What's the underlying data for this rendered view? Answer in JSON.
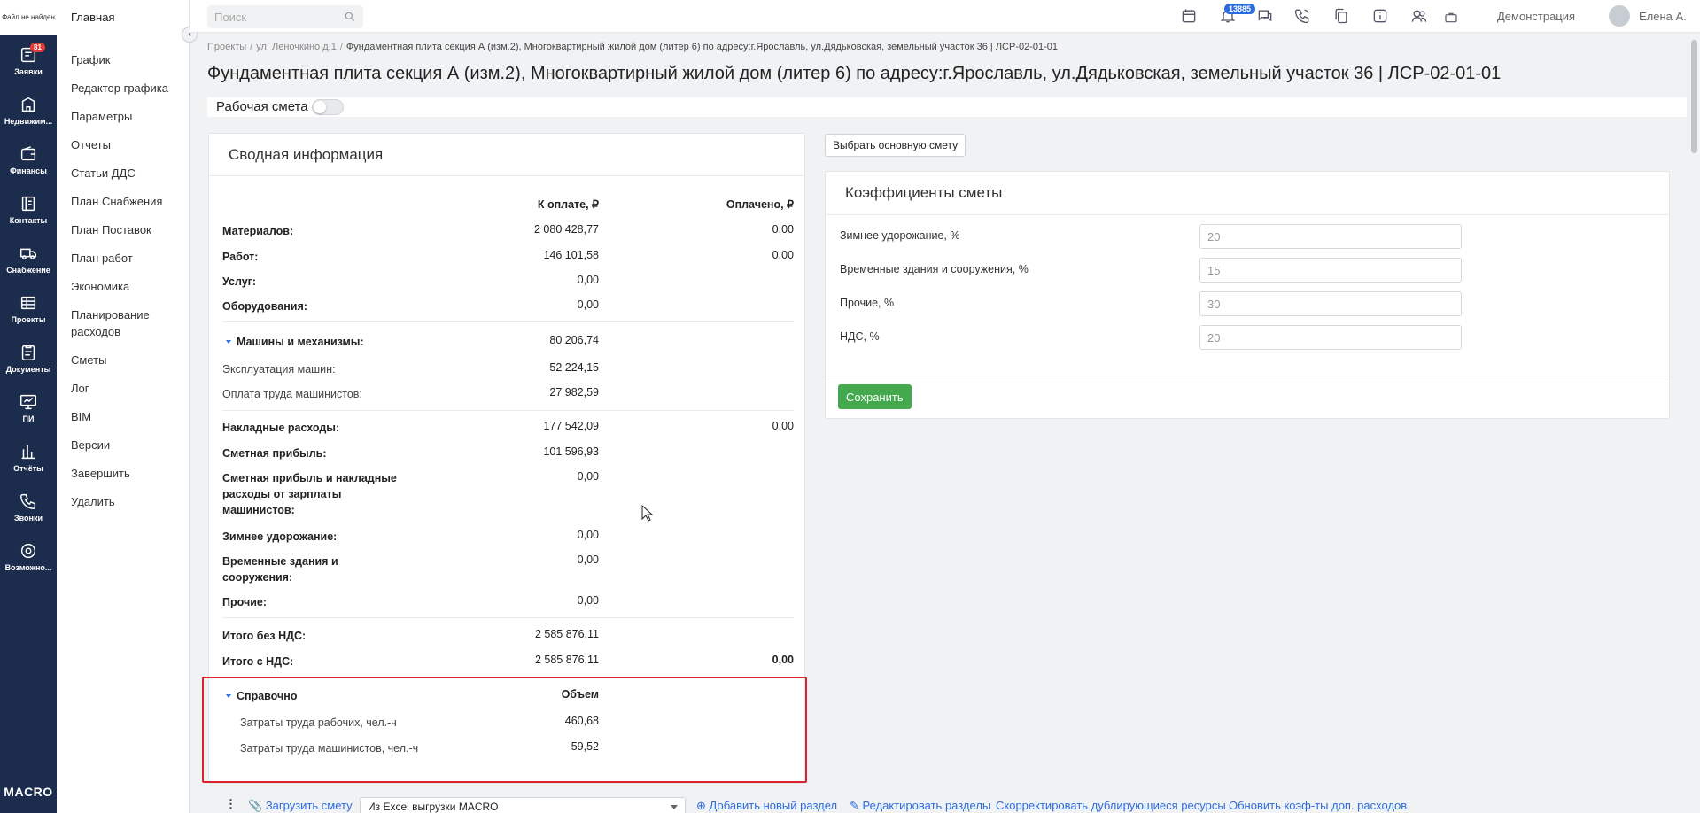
{
  "rail": {
    "logo_text": "Файл не найден",
    "items": [
      {
        "label": "Заявки",
        "icon": "requests-icon",
        "badge": "81"
      },
      {
        "label": "Недвижим...",
        "icon": "building-icon"
      },
      {
        "label": "Финансы",
        "icon": "wallet-icon"
      },
      {
        "label": "Контакты",
        "icon": "contacts-icon"
      },
      {
        "label": "Снабжение",
        "icon": "truck-icon"
      },
      {
        "label": "Проекты",
        "icon": "projects-icon"
      },
      {
        "label": "Документы",
        "icon": "documents-icon"
      },
      {
        "label": "ПИ",
        "icon": "monitor-icon"
      },
      {
        "label": "Отчёты",
        "icon": "chart-icon"
      },
      {
        "label": "Звонки",
        "icon": "phone-icon"
      },
      {
        "label": "Возможно...",
        "icon": "gear-icon"
      }
    ],
    "brand": "MACRO"
  },
  "nav": {
    "home": "Главная",
    "items": [
      "График",
      "Редактор графика",
      "Параметры",
      "Отчеты",
      "Статьи ДДС",
      "План Снабжения",
      "План Поставок",
      "План работ",
      "Экономика",
      "Планирование расходов",
      "Сметы",
      "Лог",
      "BIM",
      "Версии",
      "Завершить",
      "Удалить"
    ]
  },
  "topbar": {
    "search_placeholder": "Поиск",
    "notifications_badge": "13885",
    "demo_label": "Демонстрация",
    "user_name": "Елена А."
  },
  "breadcrumb": [
    "Проекты",
    "ул. Леночкино д.1",
    "Фундаментная плита секция А (изм.2), Многоквартирный жилой дом (литер 6) по адресу:г.Ярославль, ул.Дядьковская, земельный участок 36 | ЛСР-02-01-01"
  ],
  "page_title": "Фундаментная плита секция А (изм.2), Многоквартирный жилой дом (литер 6) по адресу:г.Ярославль, ул.Дядьковская, земельный участок 36 | ЛСР-02-01-01",
  "working_estimate_label": "Рабочая смета",
  "summary": {
    "title": "Сводная информация",
    "col_to_pay": "К оплате, ₽",
    "col_paid": "Оплачено, ₽",
    "rows": [
      {
        "label": "Материалов:",
        "to_pay": "2 080 428,77",
        "paid": "0,00"
      },
      {
        "label": "Работ:",
        "to_pay": "146 101,58",
        "paid": "0,00"
      },
      {
        "label": "Услуг:",
        "to_pay": "0,00",
        "paid": ""
      },
      {
        "label": "Оборудования:",
        "to_pay": "0,00",
        "paid": ""
      },
      {
        "label": "Машины и механизмы:",
        "to_pay": "80 206,74",
        "paid": ""
      },
      {
        "label": "Эксплуатация машин:",
        "to_pay": "52 224,15",
        "paid": ""
      },
      {
        "label": "Оплата труда машинистов:",
        "to_pay": "27 982,59",
        "paid": ""
      },
      {
        "label": "Накладные расходы:",
        "to_pay": "177 542,09",
        "paid": "0,00"
      },
      {
        "label": "Сметная прибыль:",
        "to_pay": "101 596,93",
        "paid": ""
      },
      {
        "label": "Сметная прибыль и накладные расходы от зарплаты машинистов:",
        "to_pay": "0,00",
        "paid": ""
      },
      {
        "label": "Зимнее удорожание:",
        "to_pay": "0,00",
        "paid": ""
      },
      {
        "label": "Временные здания и сооружения:",
        "to_pay": "0,00",
        "paid": ""
      },
      {
        "label": "Прочие:",
        "to_pay": "0,00",
        "paid": ""
      },
      {
        "label": "Итого без НДС:",
        "to_pay": "2 585 876,11",
        "paid": ""
      },
      {
        "label": "Итого с НДС:",
        "to_pay": "2 585 876,11",
        "paid": "0,00"
      }
    ],
    "reference": {
      "label": "Справочно",
      "volume_col": "Объем",
      "rows": [
        {
          "label": "Затраты труда рабочих, чел.-ч",
          "value": "460,68"
        },
        {
          "label": "Затраты труда машинистов, чел.-ч",
          "value": "59,52"
        }
      ]
    }
  },
  "choose_main_button": "Выбрать основную смету",
  "coefficients": {
    "title": "Коэффициенты сметы",
    "rows": [
      {
        "label": "Зимнее удорожание, %",
        "value": "20"
      },
      {
        "label": "Временные здания и сооружения, %",
        "value": "15"
      },
      {
        "label": "Прочие, %",
        "value": "30"
      },
      {
        "label": "НДС, %",
        "value": "20"
      }
    ],
    "save": "Сохранить"
  },
  "bottom": {
    "upload": "Загрузить смету",
    "select_value": "Из Excel выгрузки MACRO",
    "add_section": "Добавить новый раздел",
    "edit_sections": "Редактировать разделы",
    "fix_duplicates": "Скорректировать дублирующиеся ресурсы",
    "update_coef": "Обновить коэф-ты доп. расходов"
  }
}
